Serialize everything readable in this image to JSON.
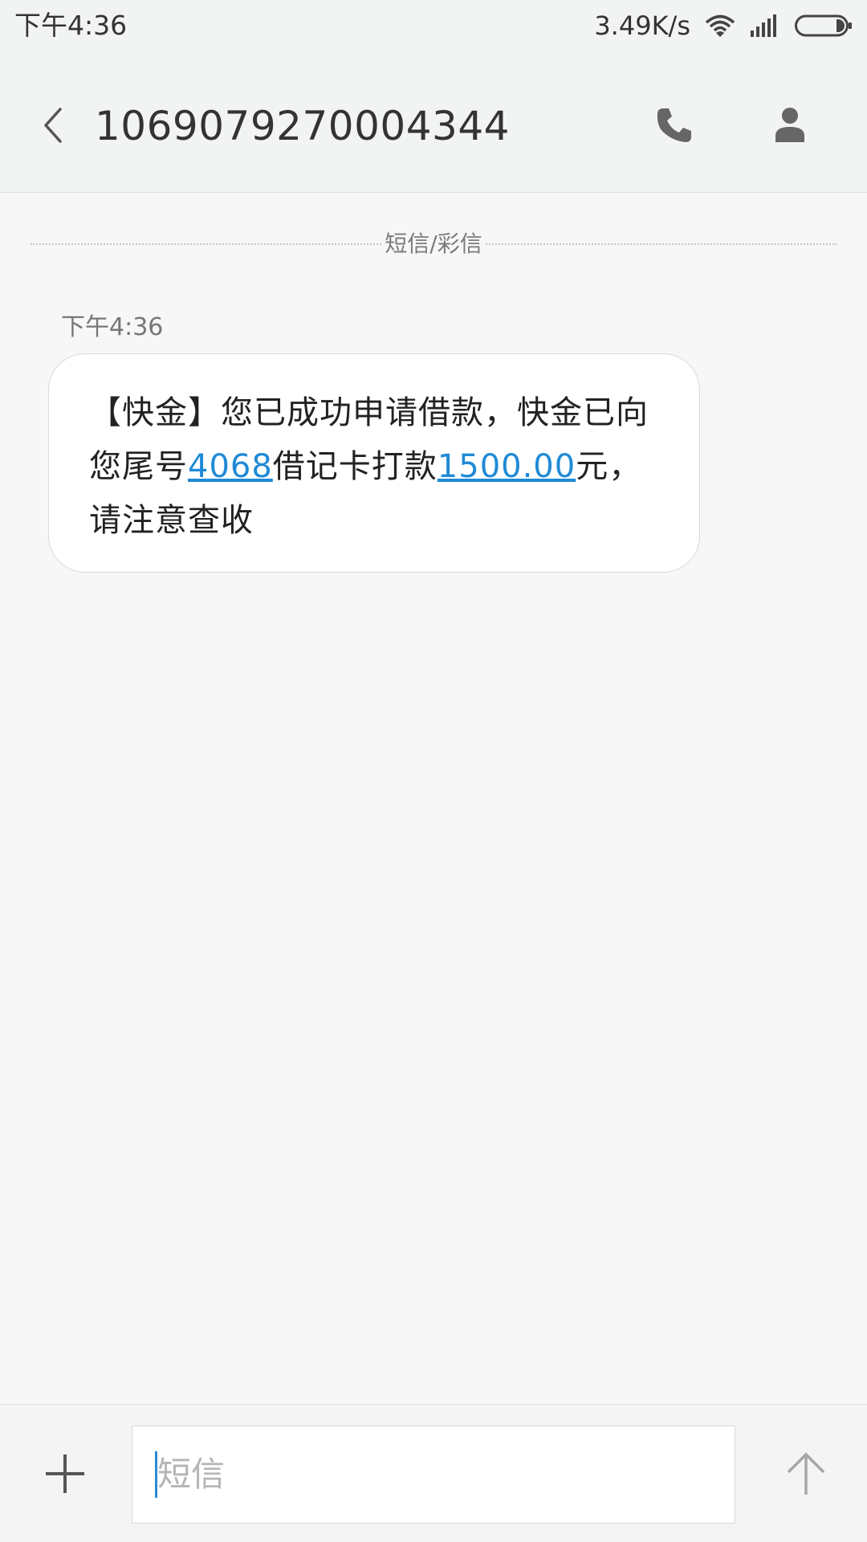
{
  "status_bar": {
    "time": "下午4:36",
    "net_speed": "3.49K/s",
    "icons": [
      "wifi-icon",
      "signal-icon",
      "battery-icon"
    ]
  },
  "header": {
    "title": "1069079270004344",
    "back_icon": "chevron-left-icon",
    "call_icon": "phone-icon",
    "contact_icon": "person-icon"
  },
  "conversation": {
    "channel_label": "短信/彩信",
    "messages": [
      {
        "time": "下午4:36",
        "text_parts": {
          "p1": "【快金】您已成功申请借款，快金已向您尾号",
          "card_tail": "4068",
          "p2": "借记卡打款",
          "amount": "1500.00",
          "p3": "元，请注意查收"
        }
      }
    ]
  },
  "composer": {
    "attach_icon": "plus-icon",
    "placeholder": "短信",
    "send_icon": "arrow-up-icon"
  },
  "colors": {
    "link": "#1f8ad6",
    "header_bg": "#f2f3f3",
    "page_bg": "#f7f7f7",
    "caret": "#2c8ad8"
  }
}
